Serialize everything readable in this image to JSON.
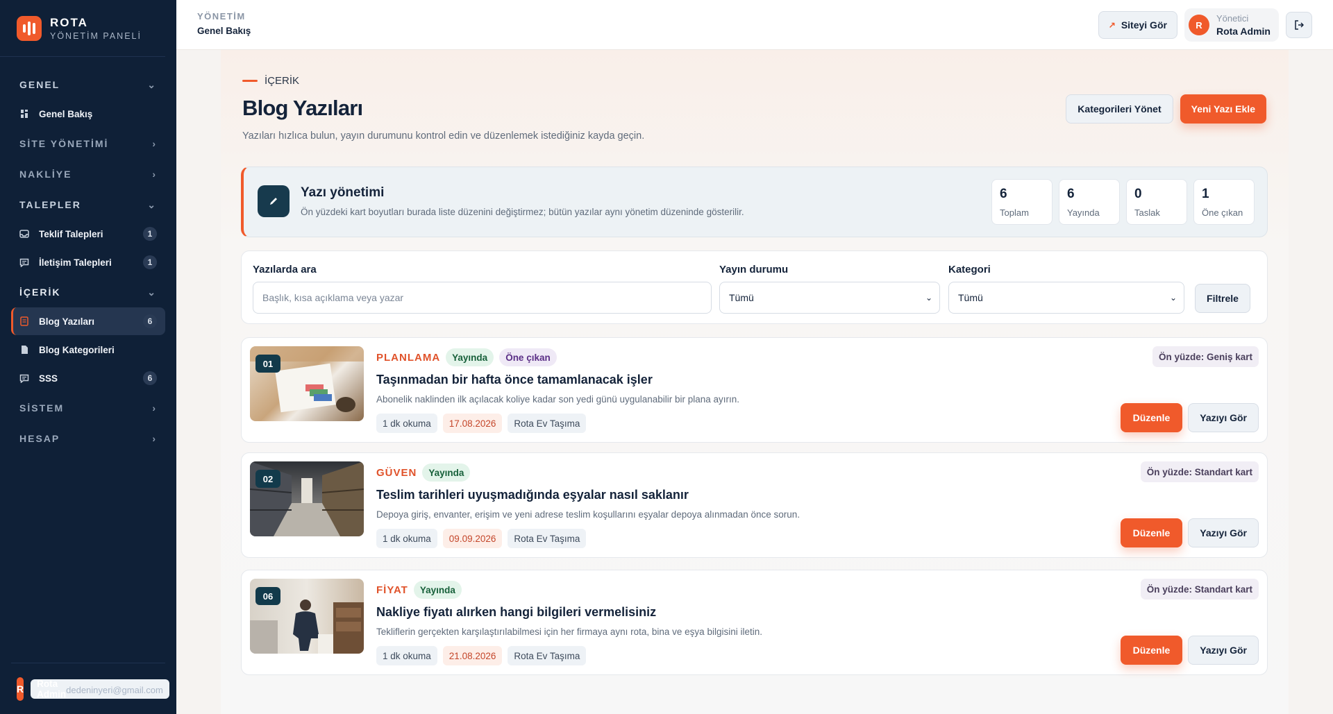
{
  "sidebar": {
    "brand_name": "ROTA",
    "brand_sub": "YÖNETİM PANELİ",
    "sections": {
      "genel": "GENEL",
      "site": "SİTE YÖNETİMİ",
      "nakliye": "NAKLİYE",
      "talepler": "TALEPLER",
      "icerik": "İÇERİK",
      "sistem": "SİSTEM",
      "hesap": "HESAP"
    },
    "items": {
      "genel_bakis": "Genel Bakış",
      "teklif": "Teklif Talepleri",
      "teklif_count": "1",
      "iletisim": "İletişim Talepleri",
      "iletisim_count": "1",
      "blog": "Blog Yazıları",
      "blog_count": "6",
      "blog_kat": "Blog Kategorileri",
      "sss": "SSS",
      "sss_count": "6"
    },
    "user": {
      "initial": "R",
      "name": "Rota Admin",
      "email": "dedeninyeri@gmail.com"
    }
  },
  "header": {
    "section": "YÖNETİM",
    "page": "Genel Bakış",
    "view_site": "Siteyi Gör",
    "user_role": "Yönetici",
    "user_name": "Rota Admin",
    "user_initial": "R"
  },
  "main": {
    "eyebrow": "İÇERİK",
    "title": "Blog Yazıları",
    "subtitle": "Yazıları hızlıca bulun, yayın durumunu kontrol edin ve düzenlemek istediğiniz kayda geçin.",
    "manage_categories": "Kategorileri Yönet",
    "new_post": "Yeni Yazı Ekle"
  },
  "management": {
    "title": "Yazı yönetimi",
    "desc": "Ön yüzdeki kart boyutları burada liste düzenini değiştirmez; bütün yazılar aynı yönetim düzeninde gösterilir.",
    "stats": [
      {
        "value": "6",
        "label": "Toplam"
      },
      {
        "value": "6",
        "label": "Yayında"
      },
      {
        "value": "0",
        "label": "Taslak"
      },
      {
        "value": "1",
        "label": "Öne çıkan"
      }
    ]
  },
  "filters": {
    "search_label": "Yazılarda ara",
    "search_placeholder": "Başlık, kısa açıklama veya yazar",
    "status_label": "Yayın durumu",
    "status_value": "Tümü",
    "category_label": "Kategori",
    "category_value": "Tümü",
    "filter_button": "Filtrele"
  },
  "posts": [
    {
      "number": "01",
      "category": "PLANLAMA",
      "status": "Yayında",
      "featured": "Öne çıkan",
      "title": "Taşınmadan bir hafta önce tamamlanacak işler",
      "desc": "Abonelik naklinden ilk açılacak koliye kadar son yedi günü uygulanabilir bir plana ayırın.",
      "read": "1 dk okuma",
      "date": "17.08.2026",
      "author": "Rota Ev Taşıma",
      "front": "Ön yüzde: Geniş kart",
      "edit": "Düzenle",
      "view": "Yazıyı Gör"
    },
    {
      "number": "02",
      "category": "GÜVEN",
      "status": "Yayında",
      "title": "Teslim tarihleri uyuşmadığında eşyalar nasıl saklanır",
      "desc": "Depoya giriş, envanter, erişim ve yeni adrese teslim koşullarını eşyalar depoya alınmadan önce sorun.",
      "read": "1 dk okuma",
      "date": "09.09.2026",
      "author": "Rota Ev Taşıma",
      "front": "Ön yüzde: Standart kart",
      "edit": "Düzenle",
      "view": "Yazıyı Gör"
    },
    {
      "number": "06",
      "category": "FİYAT",
      "status": "Yayında",
      "title": "Nakliye fiyatı alırken hangi bilgileri vermelisiniz",
      "desc": "Tekliflerin gerçekten karşılaştırılabilmesi için her firmaya aynı rota, bina ve eşya bilgisini iletin.",
      "read": "1 dk okuma",
      "date": "21.08.2026",
      "author": "Rota Ev Taşıma",
      "front": "Ön yüzde: Standart kart",
      "edit": "Düzenle",
      "view": "Yazıyı Gör"
    }
  ],
  "icons": {
    "chevron_down": "chevron-down-icon",
    "chevron_right": "chevron-right-icon",
    "grid": "grid-icon",
    "inbox": "inbox-icon",
    "chat": "chat-icon",
    "document": "document-icon",
    "pencil": "pencil-icon",
    "external": "external-link-icon",
    "logout": "logout-icon"
  },
  "colors": {
    "accent": "#f05a2b",
    "sidebar": "#0f2037",
    "published_bg": "#e3f4ea",
    "featured_bg": "#efe9f6"
  }
}
